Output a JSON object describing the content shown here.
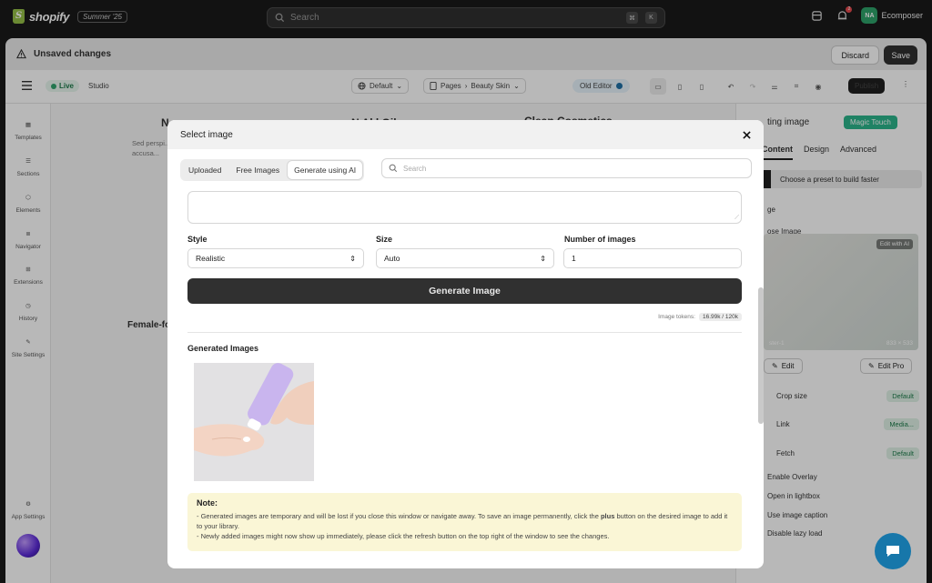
{
  "topbar": {
    "brand": "shopify",
    "edition_badge": "Summer '25",
    "search_placeholder": "Search",
    "shortcut_keys": [
      "⌘",
      "K"
    ],
    "notification_count": "2",
    "avatar_initials": "NA",
    "store_name": "Ecomposer"
  },
  "unsaved_bar": {
    "title": "Unsaved changes",
    "discard_label": "Discard",
    "save_label": "Save"
  },
  "editor_toolbar": {
    "status_label": "Live",
    "studio_label": "Studio",
    "locale_label": "Default",
    "pages_label": "Pages",
    "page_name": "Beauty Skin",
    "old_editor_label": "Old Editor",
    "publish_label": "Publish"
  },
  "left_sidebar": {
    "items": [
      {
        "label": "Templates",
        "icon": "templates-icon"
      },
      {
        "label": "Sections",
        "icon": "sections-icon"
      },
      {
        "label": "Elements",
        "icon": "elements-icon"
      },
      {
        "label": "Navigator",
        "icon": "navigator-icon"
      },
      {
        "label": "Extensions",
        "icon": "extensions-icon"
      },
      {
        "label": "History",
        "icon": "history-icon"
      },
      {
        "label": "Site Settings",
        "icon": "site-settings-icon"
      }
    ],
    "app_settings_label": "App Settings"
  },
  "canvas": {
    "headings": [
      "N",
      "N   Al   l Oil",
      "Clean Cosmetics"
    ],
    "subtext": "Sed perspi... accusa...",
    "item_label": "Female-fo"
  },
  "right_panel": {
    "title": "ting image",
    "magic_label": "Magic Touch",
    "tabs": [
      "Content",
      "Design",
      "Advanced"
    ],
    "active_tab": "Content",
    "preset_label": "Choose a preset to build faster",
    "section_label": "ge",
    "choose_image_label": "ose Image",
    "edit_ai_label": "Edit with AI",
    "image_caption_left": "ster-1",
    "image_caption_right": "833 × 533",
    "edit_label": "Edit",
    "edit_pro_label": "Edit Pro",
    "rows": [
      {
        "label": "Crop size",
        "value": "Default"
      },
      {
        "label": "Link",
        "value": "Media..."
      },
      {
        "label": "Fetch",
        "value": "Default"
      }
    ],
    "toggles": [
      "Enable Overlay",
      "Open in lightbox",
      "Use image caption",
      "Disable lazy load"
    ]
  },
  "modal": {
    "title": "Select image",
    "tabs": [
      "Uploaded",
      "Free Images",
      "Generate using AI"
    ],
    "active_tab": "Generate using AI",
    "search_placeholder": "Search",
    "style_label": "Style",
    "style_value": "Realistic",
    "size_label": "Size",
    "size_value": "Auto",
    "count_label": "Number of images",
    "count_value": "1",
    "generate_label": "Generate Image",
    "tokens_label": "Image tokens:",
    "tokens_value": "16.99k / 120k",
    "generated_title": "Generated Images",
    "note_title": "Note:",
    "note_line1_a": "- Generated images are temporary and will be lost if you close this window or navigate away. To save an image permanently, click the ",
    "note_line1_bold": "plus",
    "note_line1_b": " button on the desired image to add it to your library.",
    "note_line2": "- Newly added images might now show up immediately, please click the refresh button on the top right of the window to see the changes."
  },
  "colors": {
    "dark": "#1a1a1a",
    "accent_green": "#2bb58b",
    "chat_blue": "#1777aa",
    "note_bg": "#faf6d6"
  }
}
